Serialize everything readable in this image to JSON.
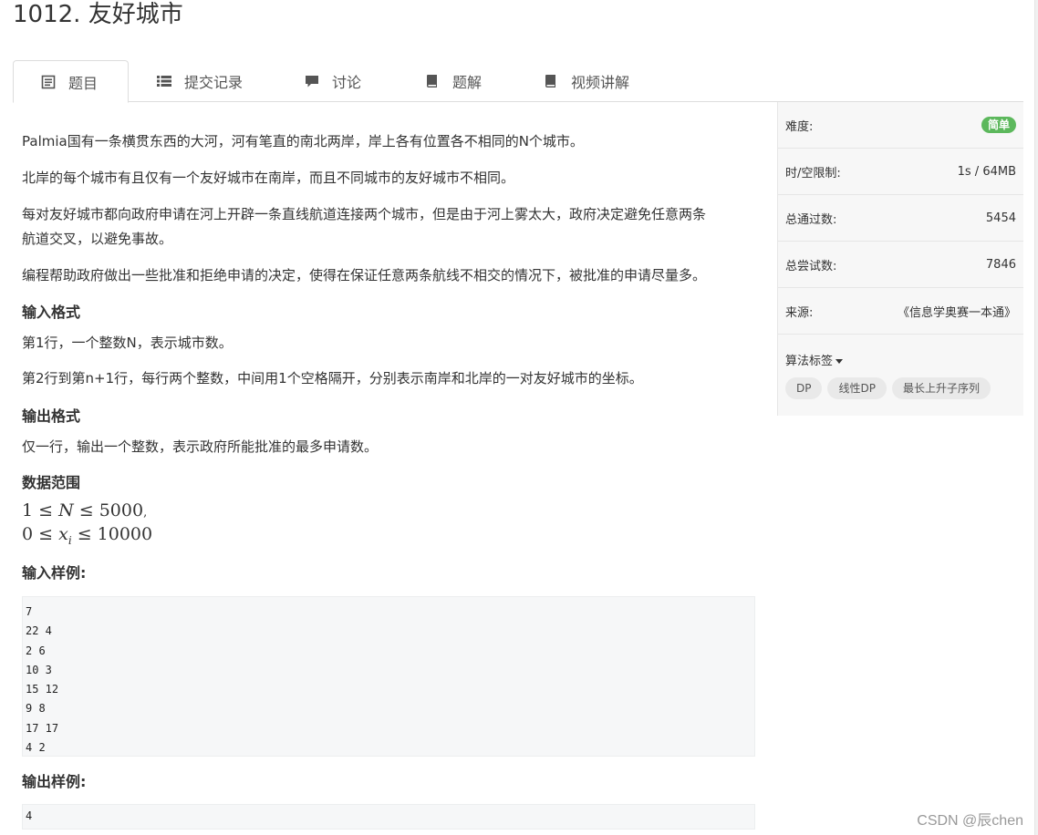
{
  "problem": {
    "title": "1012. 友好城市"
  },
  "tabs": [
    {
      "label": "题目",
      "icon": "document-icon"
    },
    {
      "label": "提交记录",
      "icon": "list-icon"
    },
    {
      "label": "讨论",
      "icon": "comment-icon"
    },
    {
      "label": "题解",
      "icon": "book-icon"
    },
    {
      "label": "视频讲解",
      "icon": "book-icon"
    }
  ],
  "description": {
    "p1": "Palmia国有一条横贯东西的大河，河有笔直的南北两岸，岸上各有位置各不相同的N个城市。",
    "p2": "北岸的每个城市有且仅有一个友好城市在南岸，而且不同城市的友好城市不相同。",
    "p3a": "每对友好城市都向政府申请在河上开辟一条直线航道连接两个城市，但是由于河上雾太大，政府决定避免任意两条",
    "p3b": "航道交叉，以避免事故。",
    "p4": "编程帮助政府做出一些批准和拒绝申请的决定，使得在保证任意两条航线不相交的情况下，被批准的申请尽量多。"
  },
  "input_format": {
    "heading": "输入格式",
    "line1": "第1行，一个整数N，表示城市数。",
    "line2": "第2行到第n+1行，每行两个整数，中间用1个空格隔开，分别表示南岸和北岸的一对友好城市的坐标。"
  },
  "output_format": {
    "heading": "输出格式",
    "line1": "仅一行，输出一个整数，表示政府所能批准的最多申请数。"
  },
  "range": {
    "heading": "数据范围",
    "m1_a": "1 ≤ ",
    "m1_var": "N",
    "m1_b": " ≤ 5000",
    "m1_c": ",",
    "m2_a": "0 ≤ ",
    "m2_var": "x",
    "m2_sub": "i",
    "m2_b": " ≤ 10000"
  },
  "sample_input": {
    "heading": "输入样例:",
    "text": "7\n22 4\n2 6\n10 3\n15 12\n9 8\n17 17\n4 2"
  },
  "sample_output": {
    "heading": "输出样例:",
    "text": "4"
  },
  "sidebar": {
    "difficulty_label": "难度:",
    "difficulty_value": "简单",
    "difficulty_color": "#5cb85c",
    "limit_label": "时/空限制:",
    "limit_value": "1s / 64MB",
    "passed_label": "总通过数:",
    "passed_value": "5454",
    "tried_label": "总尝试数:",
    "tried_value": "7846",
    "source_label": "来源:",
    "source_value": "《信息学奥赛一本通》",
    "tags_label": "算法标签",
    "tags": [
      "DP",
      "线性DP",
      "最长上升子序列"
    ]
  },
  "watermark": "CSDN @辰chen"
}
